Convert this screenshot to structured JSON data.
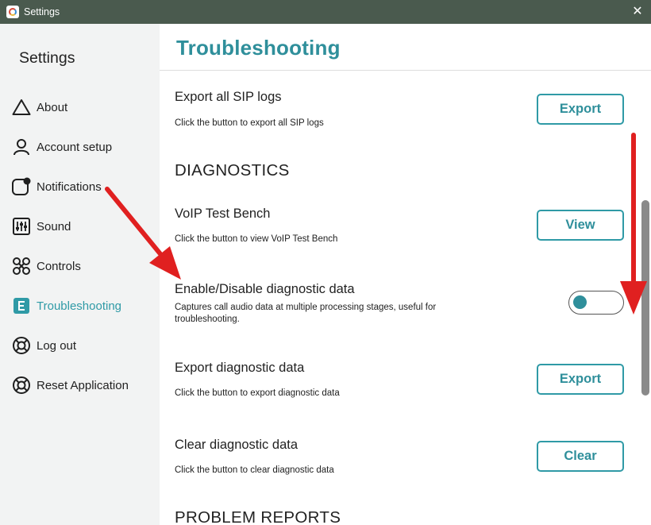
{
  "window": {
    "title": "Settings",
    "close_glyph": "✕"
  },
  "sidebar": {
    "title": "Settings",
    "items": [
      {
        "label": "About",
        "icon": "alert-triangle-icon"
      },
      {
        "label": "Account setup",
        "icon": "user-icon"
      },
      {
        "label": "Notifications",
        "icon": "notification-icon"
      },
      {
        "label": "Sound",
        "icon": "sliders-icon"
      },
      {
        "label": "Controls",
        "icon": "controls-icon"
      },
      {
        "label": "Troubleshooting",
        "icon": "troubleshooting-icon",
        "active": true
      },
      {
        "label": "Log out",
        "icon": "lifebuoy-icon"
      },
      {
        "label": "Reset Application",
        "icon": "lifebuoy-icon"
      }
    ]
  },
  "main": {
    "page_title": "Troubleshooting",
    "export_sip": {
      "title": "Export all SIP logs",
      "desc": "Click the button to export all SIP logs",
      "button": "Export"
    },
    "diagnostics_heading": "DIAGNOSTICS",
    "voip": {
      "title": "VoIP Test Bench",
      "desc": "Click the button to view VoIP Test Bench",
      "button": "View"
    },
    "diag_toggle": {
      "title": "Enable/Disable diagnostic data",
      "desc": "Captures call audio data at multiple processing stages, useful for troubleshooting.",
      "enabled": false
    },
    "export_diag": {
      "title": "Export diagnostic data",
      "desc": "Click the button to export diagnostic data",
      "button": "Export"
    },
    "clear_diag": {
      "title": "Clear diagnostic data",
      "desc": "Click the button to clear diagnostic data",
      "button": "Clear"
    },
    "problem_reports_heading": "PROBLEM REPORTS"
  },
  "colors": {
    "accent": "#2f9aa6",
    "titlebar": "#4a5a4e",
    "sidebar_bg": "#f2f3f3",
    "annotation_arrow": "#e02020"
  }
}
